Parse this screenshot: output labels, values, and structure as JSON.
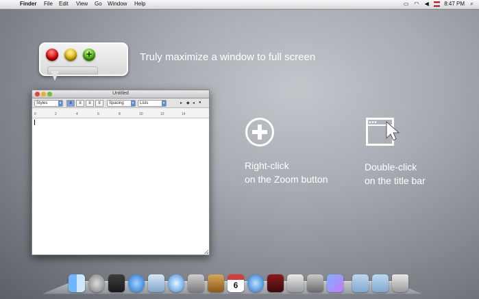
{
  "menubar": {
    "apple": "",
    "app_name": "Finder",
    "menus": [
      "File",
      "Edit",
      "View",
      "Go",
      "Window",
      "Help"
    ],
    "clock": "8:47 PM"
  },
  "callout": {
    "headline": "Truly maximize a window to full screen"
  },
  "window": {
    "title": "Untitled",
    "toolbar": {
      "styles": "Styles",
      "spacing": "Spacing",
      "lists": "Lists"
    },
    "ruler_marks": [
      "0",
      "2",
      "4",
      "6",
      "8",
      "10",
      "12",
      "14"
    ]
  },
  "hints": {
    "zoom": [
      "Right-click",
      "on the Zoom button"
    ],
    "titlebar": [
      "Double-click",
      "on the title bar"
    ]
  },
  "dock": {
    "icons": [
      "finder-icon",
      "rocket-icon",
      "dashboard-icon",
      "app-store-icon",
      "mail-icon",
      "safari-icon",
      "facetime-icon",
      "address-book-icon",
      "calendar-icon",
      "itunes-icon",
      "photo-booth-icon",
      "preview-icon",
      "system-preferences-icon",
      "documents-folder-icon",
      "downloads-folder-icon",
      "trash-icon"
    ],
    "calendar_day": "6"
  },
  "colors": {
    "traffic_red": "#d70000",
    "traffic_yellow": "#e0b500",
    "traffic_green": "#48b000"
  }
}
